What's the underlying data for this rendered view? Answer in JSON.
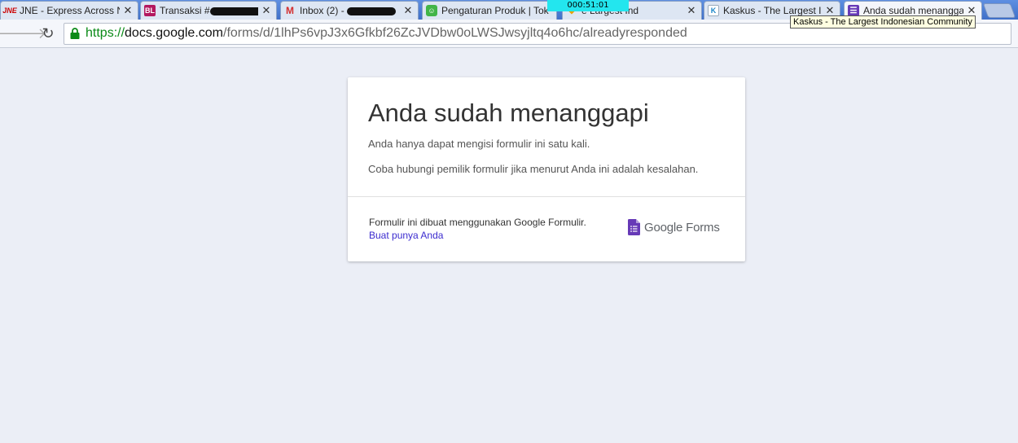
{
  "tabs": [
    {
      "title": "JNE - Express Across Na",
      "favicon": "jne-logo-icon",
      "redacted": false
    },
    {
      "title": "Transaksi #",
      "favicon": "bukalapak-icon",
      "redacted": true
    },
    {
      "title": "Inbox (2) - ",
      "favicon": "gmail-icon",
      "redacted": true
    },
    {
      "title": "Pengaturan Produk | Tok",
      "favicon": "tokopedia-icon",
      "redacted": false
    },
    {
      "title": "e Largest Ind",
      "favicon": "kaskus-icon",
      "redacted": false
    },
    {
      "title": "Kaskus - The Largest Ind",
      "favicon": "kaskus-icon",
      "redacted": false
    },
    {
      "title": "Anda sudah menanggapi",
      "favicon": "google-forms-icon",
      "redacted": false,
      "active": true
    }
  ],
  "timer": "000:51:01",
  "tooltip": "Kaskus - The Largest Indonesian Community",
  "url": {
    "scheme": "https://",
    "host": "docs.google.com",
    "path": "/forms/d/1lhPs6vpJ3x6Gfkbf26ZcJVDbw0oLWSJwsyjltq4o6hc/alreadyresponded"
  },
  "card": {
    "title": "Anda sudah menanggapi",
    "message1": "Anda hanya dapat mengisi formulir ini satu kali.",
    "message2": "Coba hubungi pemilik formulir jika menurut Anda ini adalah kesalahan.",
    "footer_text": "Formulir ini dibuat menggunakan Google Formulir.",
    "footer_link": "Buat punya Anda",
    "logo_text": "Google Forms"
  },
  "colors": {
    "forms_purple": "#673ab7",
    "link": "#3c2ccf",
    "url_scheme": "#0a8a17",
    "page_bg": "#ebeef6"
  }
}
